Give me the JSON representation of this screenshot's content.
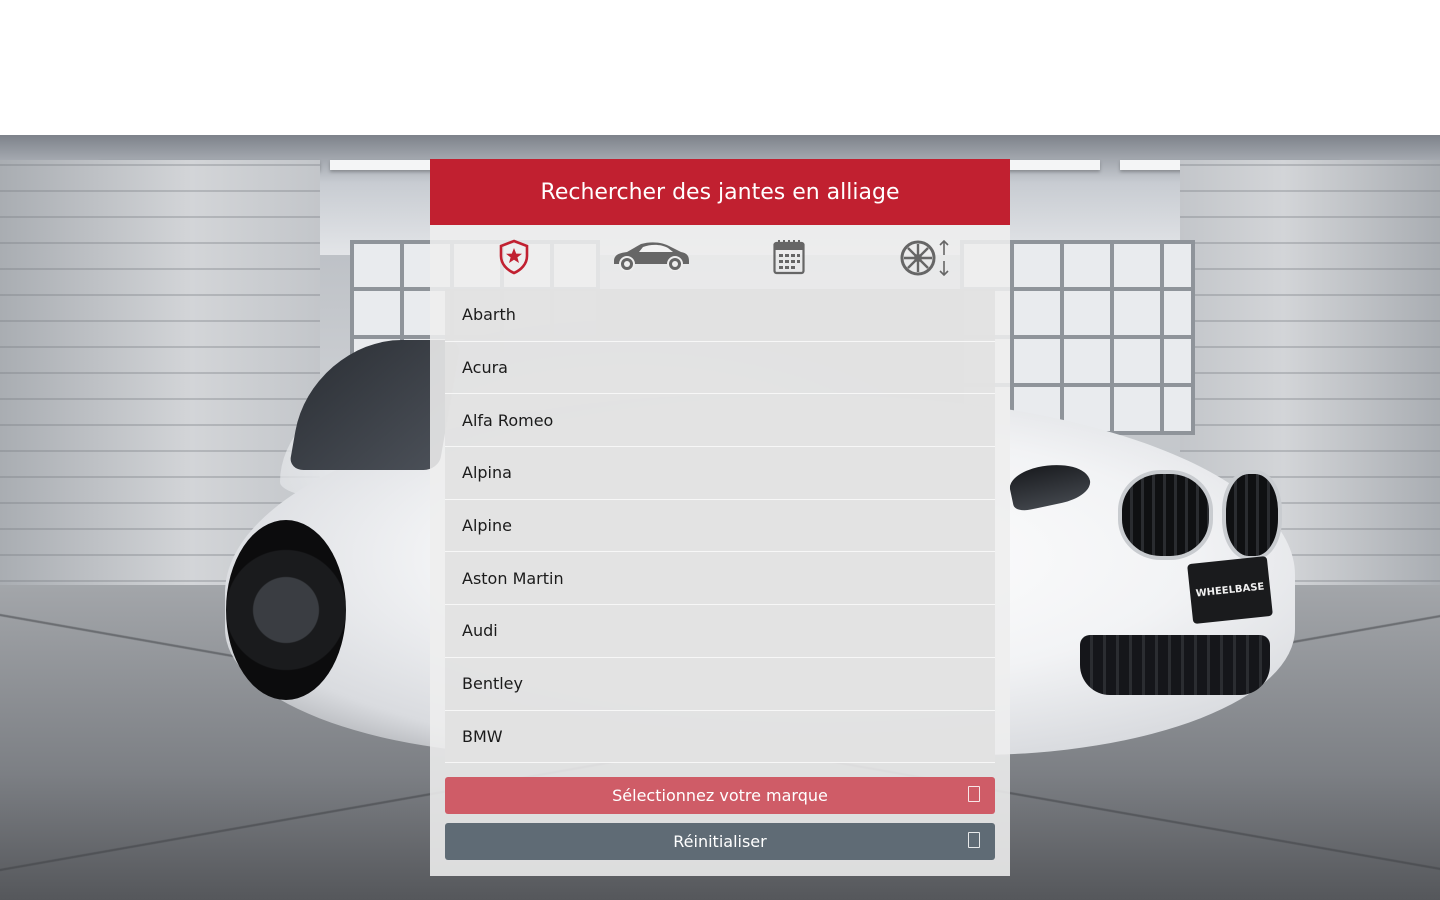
{
  "panel": {
    "title": "Rechercher des jantes en alliage",
    "steps": [
      {
        "name": "brand",
        "icon": "shield-star-icon",
        "active": true
      },
      {
        "name": "model",
        "icon": "car-icon",
        "active": false
      },
      {
        "name": "year",
        "icon": "calendar-icon",
        "active": false
      },
      {
        "name": "size",
        "icon": "wheel-size-icon",
        "active": false
      }
    ],
    "brands": [
      "Abarth",
      "Acura",
      "Alfa Romeo",
      "Alpina",
      "Alpine",
      "Aston Martin",
      "Audi",
      "Bentley",
      "BMW"
    ],
    "select_button_label": "Sélectionnez votre marque",
    "reset_button_label": "Réinitialiser"
  },
  "background": {
    "plate_text": "WHEELBASE"
  },
  "colors": {
    "header_red": "#c12030",
    "select_button": "#cf5c67",
    "reset_button": "#5f6b75",
    "active_icon": "#c12030",
    "inactive_icon": "#666666"
  }
}
